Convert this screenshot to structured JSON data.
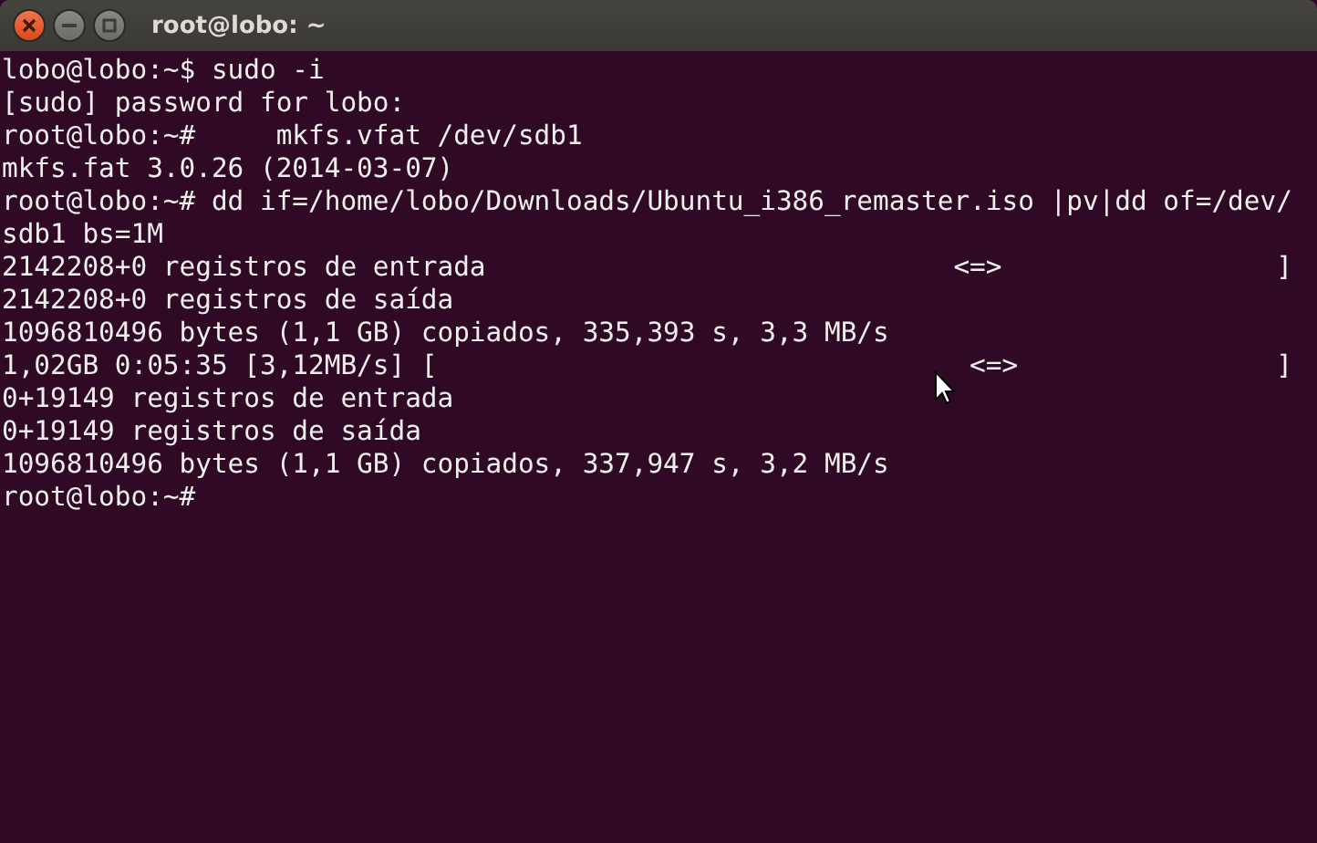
{
  "window": {
    "title": "root@lobo: ~"
  },
  "lines": [
    "lobo@lobo:~$ sudo -i",
    "[sudo] password for lobo:",
    "root@lobo:~#     mkfs.vfat /dev/sdb1",
    "mkfs.fat 3.0.26 (2014-03-07)",
    "root@lobo:~# dd if=/home/lobo/Downloads/Ubuntu_i386_remaster.iso |pv|dd of=/dev/",
    "sdb1 bs=1M",
    "2142208+0 registros de entrada                             <=>                 ]",
    "2142208+0 registros de saída",
    "1096810496 bytes (1,1 GB) copiados, 335,393 s, 3,3 MB/s",
    "1,02GB 0:05:35 [3,12MB/s] [                                 <=>                ]",
    "0+19149 registros de entrada",
    "0+19149 registros de saída",
    "1096810496 bytes (1,1 GB) copiados, 337,947 s, 3,2 MB/s",
    "root@lobo:~#"
  ]
}
